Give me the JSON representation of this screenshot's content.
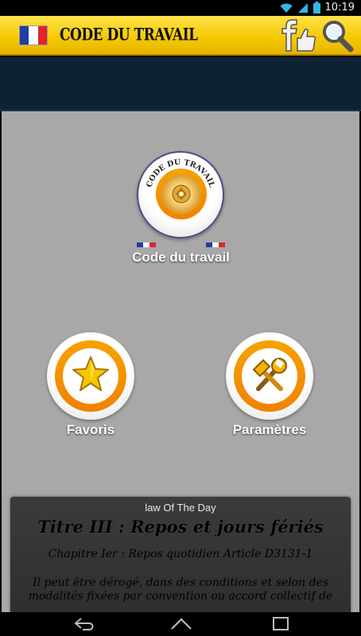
{
  "status_bar": {
    "time": "10:19"
  },
  "app_bar": {
    "title": "CODE DU TRAVAIL",
    "flag_colors": [
      "#1d3fa0",
      "#ffffff",
      "#e0242a"
    ]
  },
  "logo": {
    "ring_text": "CODE DU TRAVAIL"
  },
  "menu": {
    "code_label": "Code du travail",
    "favoris_label": "Favoris",
    "parametres_label": "Paramètres"
  },
  "law_of_day": {
    "header": "law Of The Day",
    "title": "Titre III : Repos et jours fériés",
    "chapter": "Chapitre Ier : Repos quotidien Article D3131-1",
    "body": "Il peut être dérogé, dans des conditions et selon des modalités fixées par convention ou accord collectif de"
  },
  "colors": {
    "accent_yellow": "#f5c800",
    "ring_orange": "#f39200",
    "navy": "#0f2235",
    "content_gray": "#a8a8a8"
  }
}
